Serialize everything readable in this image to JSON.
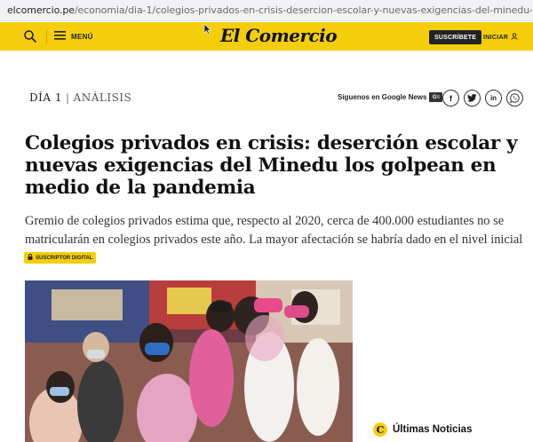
{
  "browser": {
    "url_host": "elcomercio.pe",
    "url_path": "/economia/dia-1/colegios-privados-en-crisis-desercion-escolar-y-nuevas-exigencias-del-minedu-los-golpean-en-medio-de-la..."
  },
  "nav": {
    "menu_label": "MENÚ",
    "logo": "El Comercio",
    "subscribe_label": "SUSCRÍBETE",
    "login_label": "INICIAR",
    "accent": "#f5ce0b"
  },
  "section": {
    "name": "DÍA 1",
    "separator": "|",
    "category": "ANÁLISIS"
  },
  "share": {
    "google_news_label": "Síguenos en Google News",
    "google_news_badge": "G≡",
    "facebook": "f",
    "twitter": "t",
    "linkedin": "in",
    "whatsapp": "w"
  },
  "article": {
    "title": "Colegios privados en crisis: deserción escolar y nuevas exigencias del Minedu los golpean en medio de la pandemia",
    "summary": "Gremio de colegios privados estima que, respecto al 2020, cerca de 400.000 estudiantes no se matricularán en colegios privados este año. La mayor afectación se habría dado en el nivel inicial",
    "badge": "SUSCRIPTOR DIGITAL"
  },
  "sidebar": {
    "latest_icon_letter": "C",
    "latest_label": "Últimas Noticias"
  }
}
